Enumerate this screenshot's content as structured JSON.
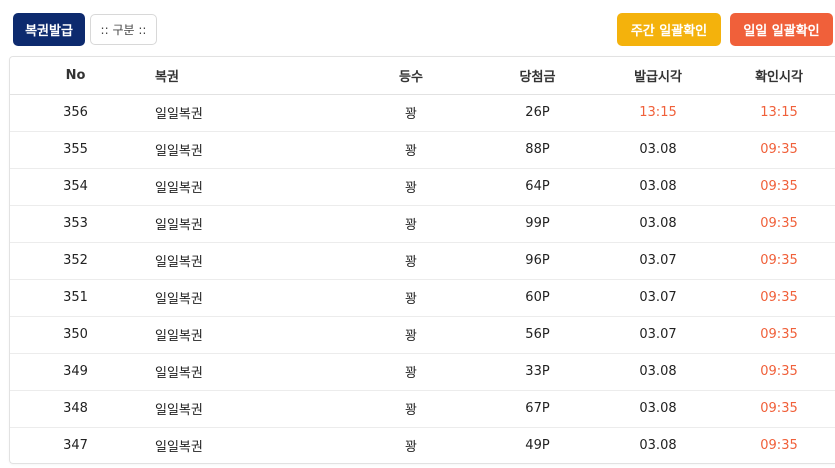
{
  "toolbar": {
    "issue_label": "복권발급",
    "category_label": ":: 구분 ::",
    "weekly_label": "주간 일괄확인",
    "daily_label": "일일 일괄확인"
  },
  "table": {
    "headers": {
      "no": "No",
      "name": "복권",
      "grade": "등수",
      "prize": "당첨금",
      "issue_time": "발급시각",
      "check_time": "확인시각"
    },
    "rows": [
      {
        "no": "356",
        "name": "일일복권",
        "grade": "꽝",
        "prize": "26P",
        "issue_time": "13:15",
        "check_time": "13:15",
        "issue_red": true
      },
      {
        "no": "355",
        "name": "일일복권",
        "grade": "꽝",
        "prize": "88P",
        "issue_time": "03.08",
        "check_time": "09:35",
        "issue_red": false
      },
      {
        "no": "354",
        "name": "일일복권",
        "grade": "꽝",
        "prize": "64P",
        "issue_time": "03.08",
        "check_time": "09:35",
        "issue_red": false
      },
      {
        "no": "353",
        "name": "일일복권",
        "grade": "꽝",
        "prize": "99P",
        "issue_time": "03.08",
        "check_time": "09:35",
        "issue_red": false
      },
      {
        "no": "352",
        "name": "일일복권",
        "grade": "꽝",
        "prize": "96P",
        "issue_time": "03.07",
        "check_time": "09:35",
        "issue_red": false
      },
      {
        "no": "351",
        "name": "일일복권",
        "grade": "꽝",
        "prize": "60P",
        "issue_time": "03.07",
        "check_time": "09:35",
        "issue_red": false
      },
      {
        "no": "350",
        "name": "일일복권",
        "grade": "꽝",
        "prize": "56P",
        "issue_time": "03.07",
        "check_time": "09:35",
        "issue_red": false
      },
      {
        "no": "349",
        "name": "일일복권",
        "grade": "꽝",
        "prize": "33P",
        "issue_time": "03.08",
        "check_time": "09:35",
        "issue_red": false
      },
      {
        "no": "348",
        "name": "일일복권",
        "grade": "꽝",
        "prize": "67P",
        "issue_time": "03.08",
        "check_time": "09:35",
        "issue_red": false
      },
      {
        "no": "347",
        "name": "일일복권",
        "grade": "꽝",
        "prize": "49P",
        "issue_time": "03.08",
        "check_time": "09:35",
        "issue_red": false
      }
    ]
  },
  "colors": {
    "navy": "#0d2a6e",
    "yellow": "#f4b20c",
    "orange": "#f0603a",
    "time_red": "#f0603a"
  }
}
